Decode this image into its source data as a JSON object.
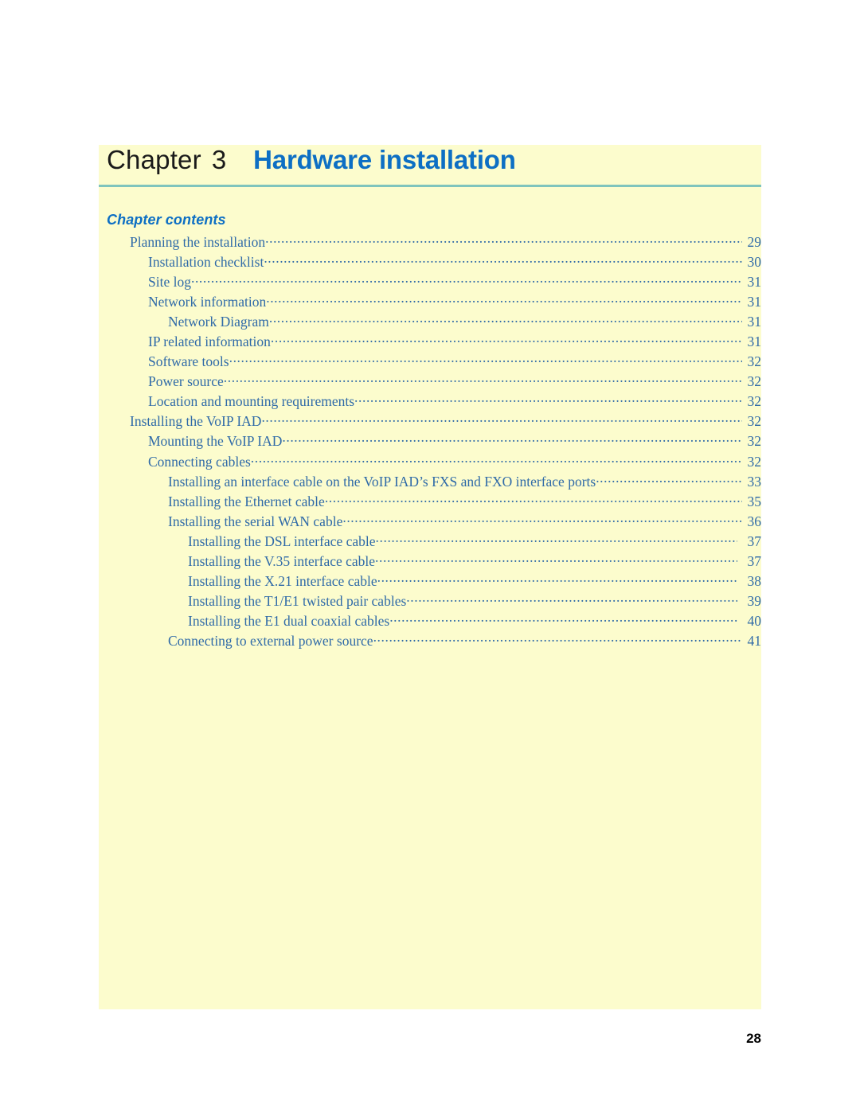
{
  "header": {
    "chapter_word": "Chapter",
    "chapter_number": "3",
    "chapter_title": "Hardware installation"
  },
  "contents": {
    "heading": "Chapter contents",
    "entries": [
      {
        "label": "Planning the installation",
        "page": "29",
        "level": 0
      },
      {
        "label": "Installation checklist",
        "page": "30",
        "level": 1
      },
      {
        "label": "Site log",
        "page": "31",
        "level": 1
      },
      {
        "label": "Network information",
        "page": "31",
        "level": 1
      },
      {
        "label": "Network Diagram",
        "page": "31",
        "level": 2
      },
      {
        "label": "IP related information",
        "page": "31",
        "level": 1
      },
      {
        "label": "Software tools",
        "page": "32",
        "level": 1
      },
      {
        "label": "Power source",
        "page": "32",
        "level": 1
      },
      {
        "label": "Location and mounting requirements",
        "page": "32",
        "level": 1
      },
      {
        "label": "Installing the VoIP IAD",
        "page": "32",
        "level": 0
      },
      {
        "label": "Mounting the VoIP IAD",
        "page": "32",
        "level": 1
      },
      {
        "label": "Connecting cables",
        "page": "32",
        "level": 1
      },
      {
        "label": "Installing an interface cable on the VoIP IAD’s FXS and FXO interface ports",
        "page": "33",
        "level": 2
      },
      {
        "label": "Installing the Ethernet cable",
        "page": "35",
        "level": 2
      },
      {
        "label": "Installing the serial WAN cable",
        "page": "36",
        "level": 2
      },
      {
        "label": "Installing the DSL interface cable",
        "page": "37",
        "level": 3
      },
      {
        "label": "Installing the V.35 interface cable",
        "page": "37",
        "level": 3
      },
      {
        "label": "Installing the X.21 interface cable",
        "page": "38",
        "level": 3
      },
      {
        "label": "Installing the T1/E1 twisted pair cables",
        "page": "39",
        "level": 3
      },
      {
        "label": "Installing the E1 dual coaxial cables",
        "page": "40",
        "level": 3
      },
      {
        "label": "Connecting to external power source",
        "page": "41",
        "level": 2
      }
    ]
  },
  "folio": {
    "page_number": "28"
  },
  "colors": {
    "page_background": "#fcfccd",
    "accent_blue": "#0d6fc4",
    "toc_blue": "#2f6aa8",
    "rule_teal": "#7fc4bd"
  }
}
